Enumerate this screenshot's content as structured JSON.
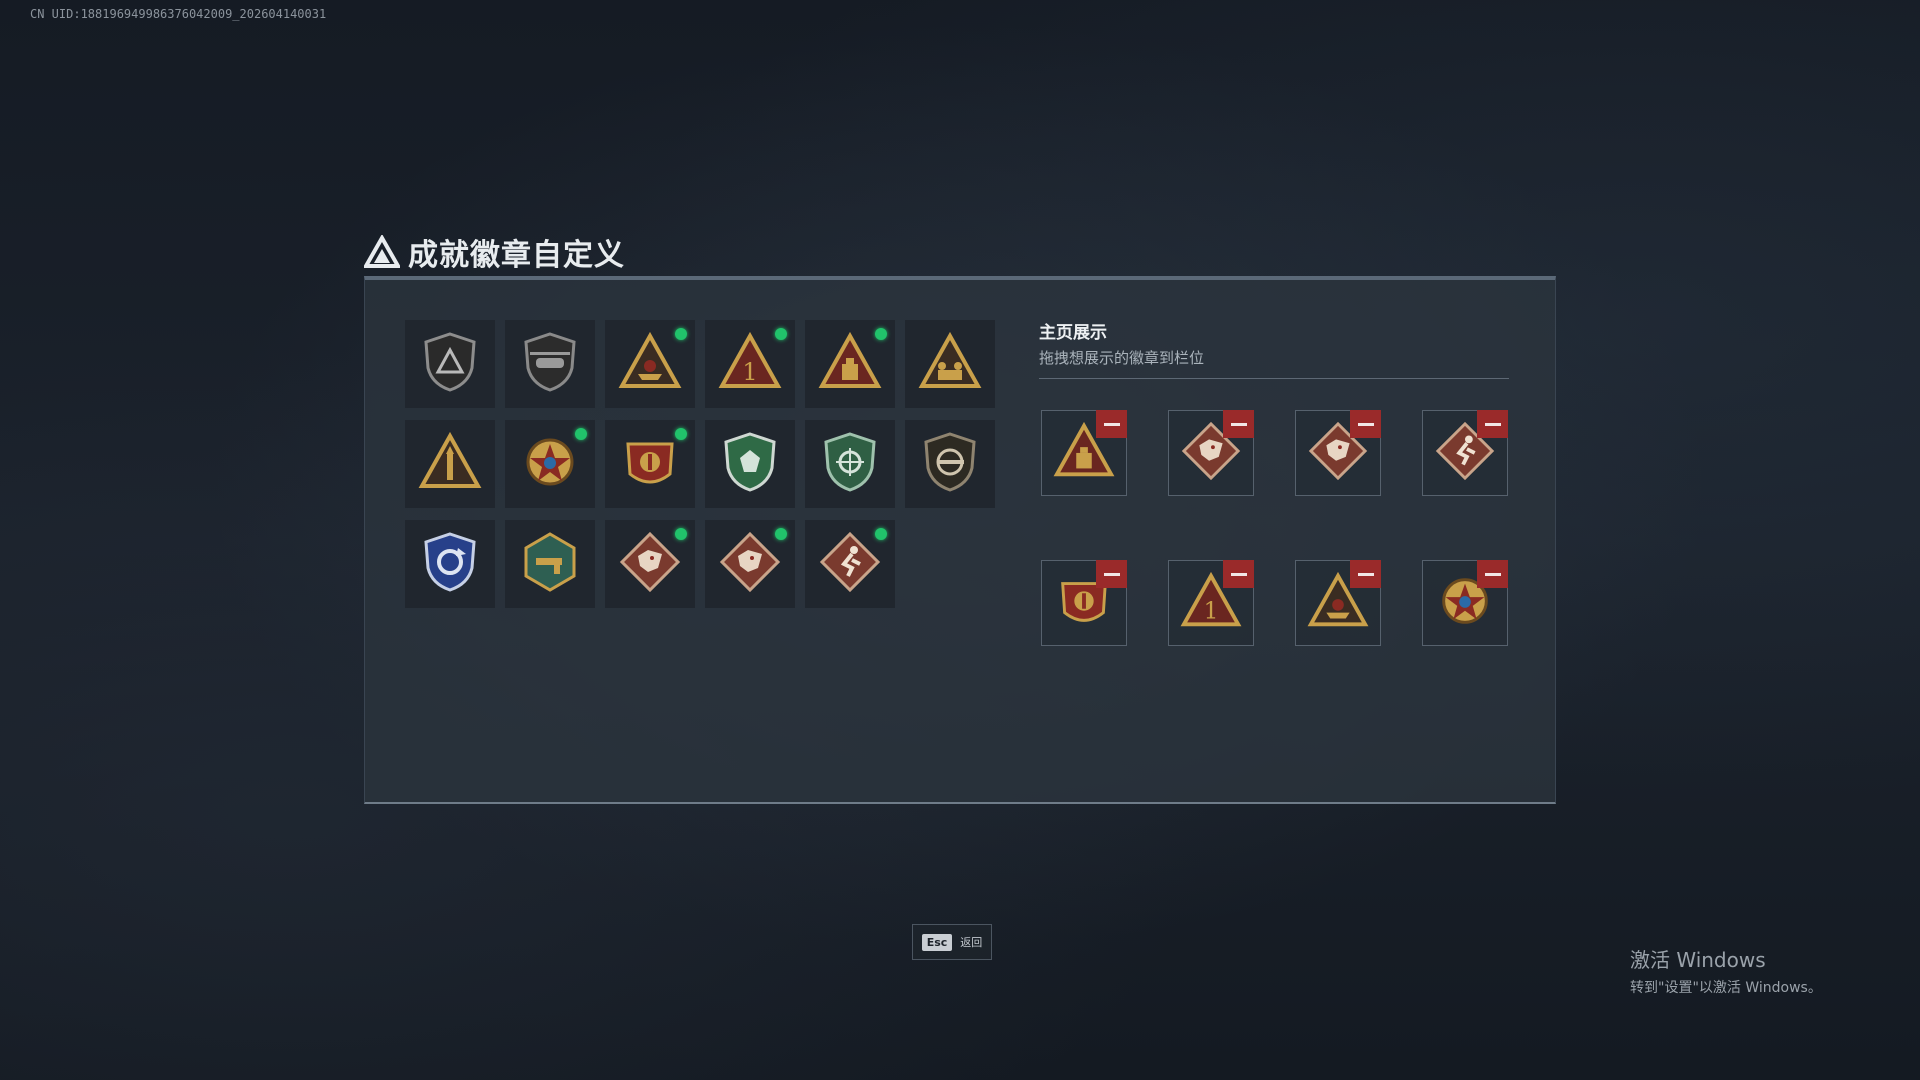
{
  "uid_text": "CN UID:18819694998637604200​9_202604140031",
  "title": "成就徽章自定义",
  "badges": [
    {
      "icon": "shield-triangle-icon",
      "new": false
    },
    {
      "icon": "helicopter-shield-icon",
      "new": false
    },
    {
      "icon": "boat-triangle-icon",
      "new": true
    },
    {
      "icon": "number-one-triangle-icon",
      "new": true
    },
    {
      "icon": "crate-triangle-icon",
      "new": true
    },
    {
      "icon": "soldiers-triangle-icon",
      "new": false
    },
    {
      "icon": "rocket-triangle-icon",
      "new": false
    },
    {
      "icon": "star-medal-icon",
      "new": true
    },
    {
      "icon": "eagle-shield-medal-icon",
      "new": true
    },
    {
      "icon": "green-gem-shield-icon",
      "new": false
    },
    {
      "icon": "green-crosshair-shield-icon",
      "new": false
    },
    {
      "icon": "rifle-shield-icon",
      "new": false
    },
    {
      "icon": "blue-arrows-shield-icon",
      "new": false
    },
    {
      "icon": "gun-hexagon-icon",
      "new": false
    },
    {
      "icon": "dragon-diamond-icon",
      "new": true
    },
    {
      "icon": "dragon-diamond-icon",
      "new": true
    },
    {
      "icon": "runner-diamond-icon",
      "new": true
    }
  ],
  "showcase": {
    "title": "主页展示",
    "subtitle": "拖拽想展示的徽章到栏位",
    "slots": [
      {
        "icon": "crate-triangle-icon"
      },
      {
        "icon": "dragon-diamond-icon"
      },
      {
        "icon": "dragon-diamond-icon"
      },
      {
        "icon": "runner-diamond-icon"
      },
      {
        "icon": "eagle-shield-medal-icon"
      },
      {
        "icon": "number-one-triangle-icon"
      },
      {
        "icon": "boat-triangle-icon"
      },
      {
        "icon": "star-medal-icon"
      }
    ]
  },
  "esc": {
    "key": "Esc",
    "label": "返回"
  },
  "watermark": {
    "title": "激活 Windows",
    "subtitle": "转到\"设置\"以激活 Windows。"
  },
  "colors": {
    "new_dot": "#21c36b",
    "remove": "#9a2a2a",
    "gold": "#c9a04a",
    "red": "#8a2a22"
  }
}
